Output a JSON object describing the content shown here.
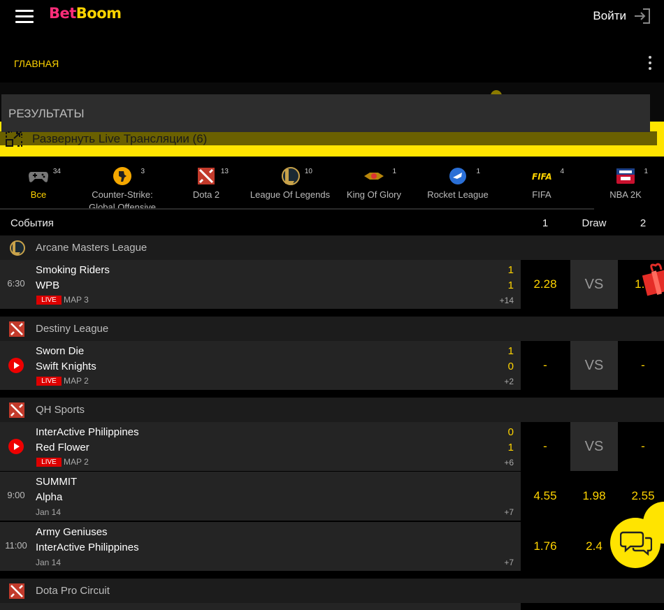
{
  "header": {
    "logo_part1": "Bet",
    "logo_part2": "Boom",
    "login_label": "Войти"
  },
  "nav": {
    "home_label": "ГЛАВНАЯ"
  },
  "live_panel": {
    "results_label": "РЕЗУЛЬТАТЫ",
    "expand_label": "Развернуть Live Трансляции (6)"
  },
  "games": [
    {
      "label": "Все",
      "count": "34",
      "icon": "gamepad-icon"
    },
    {
      "label": "Counter-Strike: Global Offensive",
      "count": "3",
      "icon": "csgo-icon"
    },
    {
      "label": "Dota 2",
      "count": "13",
      "icon": "dota-icon"
    },
    {
      "label": "League Of Legends",
      "count": "10",
      "icon": "lol-icon"
    },
    {
      "label": "King Of Glory",
      "count": "1",
      "icon": "king-of-glory-icon"
    },
    {
      "label": "Rocket League",
      "count": "1",
      "icon": "rocket-league-icon"
    },
    {
      "label": "FIFA",
      "count": "4",
      "icon": "fifa-icon"
    },
    {
      "label": "NBA 2K",
      "count": "1",
      "icon": "nba2k-icon"
    }
  ],
  "columns": {
    "events": "События",
    "one": "1",
    "draw": "Draw",
    "two": "2"
  },
  "leagues": [
    {
      "name": "Arcane Masters League",
      "icon": "lol-icon"
    },
    {
      "name": "Destiny League",
      "icon": "dota-icon"
    },
    {
      "name": "QH Sports",
      "icon": "dota-icon"
    },
    {
      "name": "Dota Pro Circuit",
      "icon": "dota-icon"
    }
  ],
  "matches": [
    {
      "time": "6:30",
      "team1": "Smoking Riders",
      "team2": "WPB",
      "score1": "1",
      "score2": "1",
      "live": "LIVE",
      "map": "MAP 3",
      "more": "+14",
      "odd1": "2.28",
      "odd_draw": "VS",
      "odd2": "1.5"
    },
    {
      "team1": "Sworn Die",
      "team2": "Swift Knights",
      "score1": "1",
      "score2": "0",
      "live": "LIVE",
      "map": "MAP 2",
      "more": "+2",
      "odd1": "-",
      "odd_draw": "VS",
      "odd2": "-"
    },
    {
      "team1": "InterActive Philippines",
      "team2": "Red Flower",
      "score1": "0",
      "score2": "1",
      "live": "LIVE",
      "map": "MAP 2",
      "more": "+6",
      "odd1": "-",
      "odd_draw": "VS",
      "odd2": "-"
    },
    {
      "time": "9:00",
      "team1": "SUMMIT",
      "team2": "Alpha",
      "date": "Jan 14",
      "more": "+7",
      "odd1": "4.55",
      "odd_draw": "1.98",
      "odd2": "2.55"
    },
    {
      "time": "11:00",
      "team1": "Army Geniuses",
      "team2": "InterActive Philippines",
      "date": "Jan 14",
      "more": "+7",
      "odd1": "1.76",
      "odd_draw": "2.4",
      "odd2": ""
    }
  ],
  "colors": {
    "accent": "#ffd400",
    "live": "#dd0000",
    "row_bg": "#242424",
    "league_bg": "#1c1c1c"
  }
}
